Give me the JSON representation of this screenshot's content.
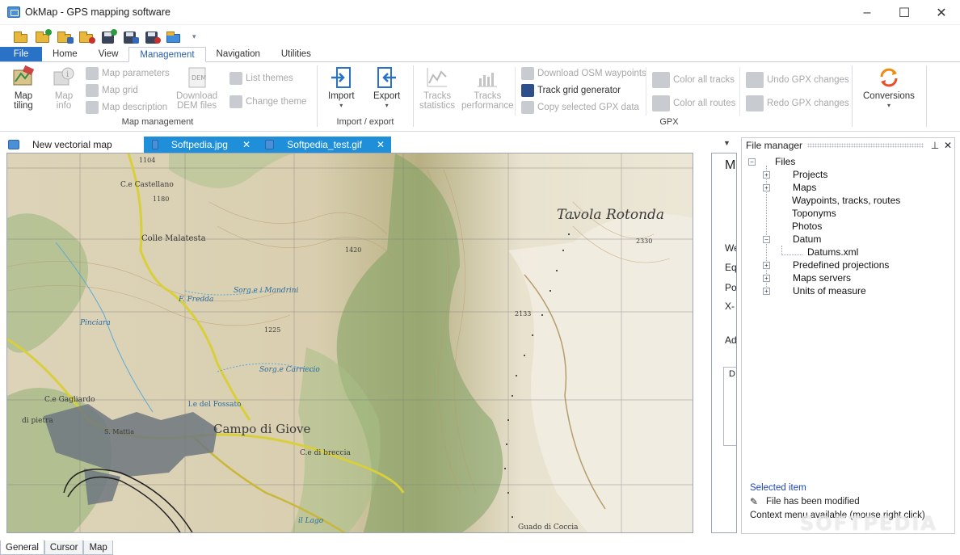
{
  "window": {
    "title": "OkMap - GPS mapping software",
    "minimize": "–",
    "maximize": "☐",
    "close": "✕"
  },
  "quick_access": {
    "icons": [
      "open-folder-icon",
      "open-folder-icon",
      "open-folder-add-icon",
      "open-folder-remove-icon",
      "save-icon",
      "save-as-icon",
      "save-all-icon",
      "folder-icon"
    ],
    "dropdown": "▾"
  },
  "ribbon_tabs": [
    "File",
    "Home",
    "View",
    "Management",
    "Navigation",
    "Utilities"
  ],
  "active_tab": "Management",
  "ribbon": {
    "map_management": {
      "label": "Map management",
      "map_tiling": "Map\ntiling",
      "map_info": "Map\ninfo",
      "map_parameters": "Map parameters",
      "map_grid": "Map grid",
      "map_description": "Map description",
      "download_dem": "Download\nDEM files",
      "dem_icon_text": "DEM",
      "list_themes": "List themes",
      "change_theme": "Change theme"
    },
    "import_export": {
      "label": "Import / export",
      "import": "Import",
      "export": "Export"
    },
    "gpx": {
      "label": "GPX",
      "tracks_statistics": "Tracks\nstatistics",
      "tracks_performance": "Tracks\nperformance",
      "download_osm": "Download OSM waypoints",
      "track_grid": "Track grid generator",
      "copy_gpx": "Copy selected GPX data",
      "color_tracks": "Color all tracks",
      "color_routes": "Color all routes",
      "undo_gpx": "Undo GPX changes",
      "redo_gpx": "Redo GPX changes"
    },
    "conversions": {
      "label": "Conversions"
    }
  },
  "doc_tabs": [
    {
      "label": "New vectorial map",
      "selected": false
    },
    {
      "label": "Softpedia.jpg",
      "selected": true
    },
    {
      "label": "Softpedia_test.gif",
      "selected": true
    }
  ],
  "map_labels": {
    "tavola": "Tavola Rotonda",
    "campo": "Campo di Giove",
    "castellano": "C.e Castellano",
    "malatesta": "Colle Malatesta",
    "fredda": "F. Fredda",
    "mandrini": "Sorg.e i Mandrini",
    "carriccio": "Sorg.e Carriccio",
    "pinciara": "Pinciara",
    "breccia": "C.e di breccia",
    "lago": "il Lago",
    "coccia": "Guado di Coccia",
    "gagliardo": "C.e Gagliardo",
    "pietra": "di pietra",
    "fossato": "l.e del Fossato",
    "mattia": "S. Mattia",
    "elev_2330": "2330",
    "elev_2133": "2133",
    "elev_1225": "1225",
    "elev_1420": "1420",
    "elev_1104": "1104",
    "elev_1180": "1180"
  },
  "info_panel": {
    "heading": "M",
    "line1": "We",
    "line2": "Eq",
    "line3": "Po",
    "line4": "X-",
    "line5": "Ad",
    "box": "D"
  },
  "file_manager": {
    "title": "File manager",
    "pin": "📌",
    "close": "✕",
    "root": "Files",
    "items": [
      "Projects",
      "Maps",
      "Waypoints, tracks, routes",
      "Toponyms",
      "Photos",
      "Datum",
      "Datums.xml",
      "Predefined projections",
      "Maps servers",
      "Units of measure"
    ],
    "status": {
      "selected_label": "Selected item",
      "modified": "File has been modified",
      "context": "Context menu available (mouse right click)"
    }
  },
  "bottom_tabs": [
    "General",
    "Cursor",
    "Map"
  ],
  "watermark": "SOFTPEDIA"
}
